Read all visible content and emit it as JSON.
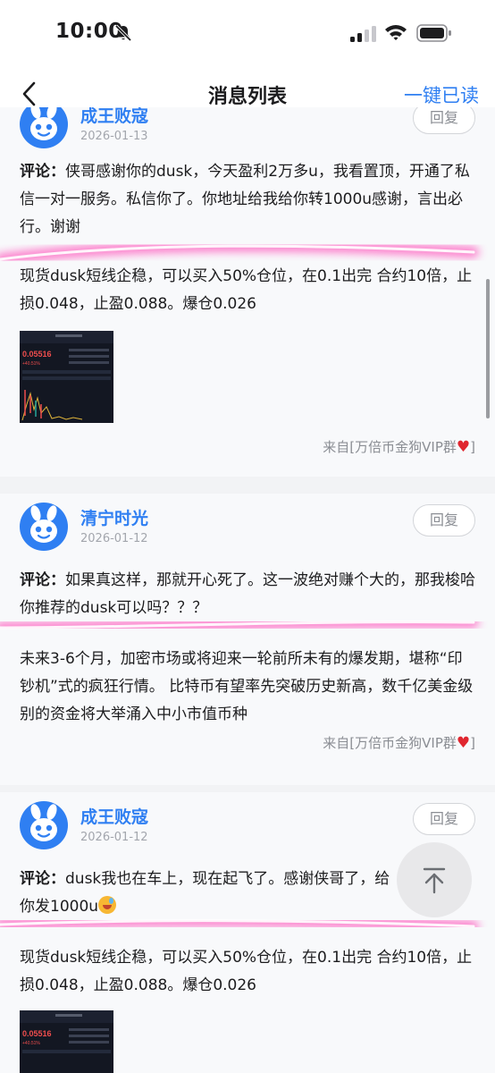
{
  "status_bar": {
    "time": "10:00"
  },
  "nav": {
    "title": "消息列表",
    "mark_all_read": "一键已读"
  },
  "cards": [
    {
      "user": "成王败寇",
      "date": "2026-01-13",
      "reply": "回复",
      "comment_prefix": "评论：",
      "comment": "侠哥感谢你的dusk，今天盈利2万多u，我看置顶，开通了私信一对一服务。私信你了。你地址给我给你转1000u感谢，言出必行。谢谢",
      "body": "现货dusk短线企稳，可以买入50%仓位，在0.1出完 合约10倍，止损0.048，止盈0.088。爆仓0.026",
      "source": "来自[万倍币金狗VIP群"
    },
    {
      "user": "清宁时光",
      "date": "2026-01-12",
      "reply": "回复",
      "comment_prefix": "评论：",
      "comment": "如果真这样，那就开心死了。这一波绝对赚个大的，那我梭哈你推荐的dusk可以吗？？？",
      "body": "未来3-6个月，加密市场或将迎来一轮前所未有的爆发期，堪称“印钞机”式的疯狂行情。 比特币有望率先突破历史新高，数千亿美金级别的资金将大举涌入中小市值币种",
      "source": "来自[万倍币金狗VIP群"
    },
    {
      "user": "成王败寇",
      "date": "2026-01-12",
      "reply": "回复",
      "comment_prefix": "评论：",
      "comment": "dusk我也在车上，现在起飞了。感谢侠哥了，给你发1000u",
      "body": "现货dusk短线企稳，可以买入50%仓位，在0.1出完 合约10倍，止损0.048，止盈0.088。爆仓0.026",
      "source": "来自[万倍币金狗VIP群"
    }
  ],
  "thumb_text": {
    "price": "0.05516",
    "change": "+40.51%"
  },
  "colors": {
    "accent": "#2f7ff2",
    "highlight": "#ff3fb4",
    "heart": "#e0262f"
  },
  "icons": [
    "bell-slash-icon",
    "signal-icon",
    "wifi-icon",
    "battery-icon",
    "back-chevron-icon",
    "avatar-icon",
    "heart-icon",
    "arrow-up-icon"
  ]
}
